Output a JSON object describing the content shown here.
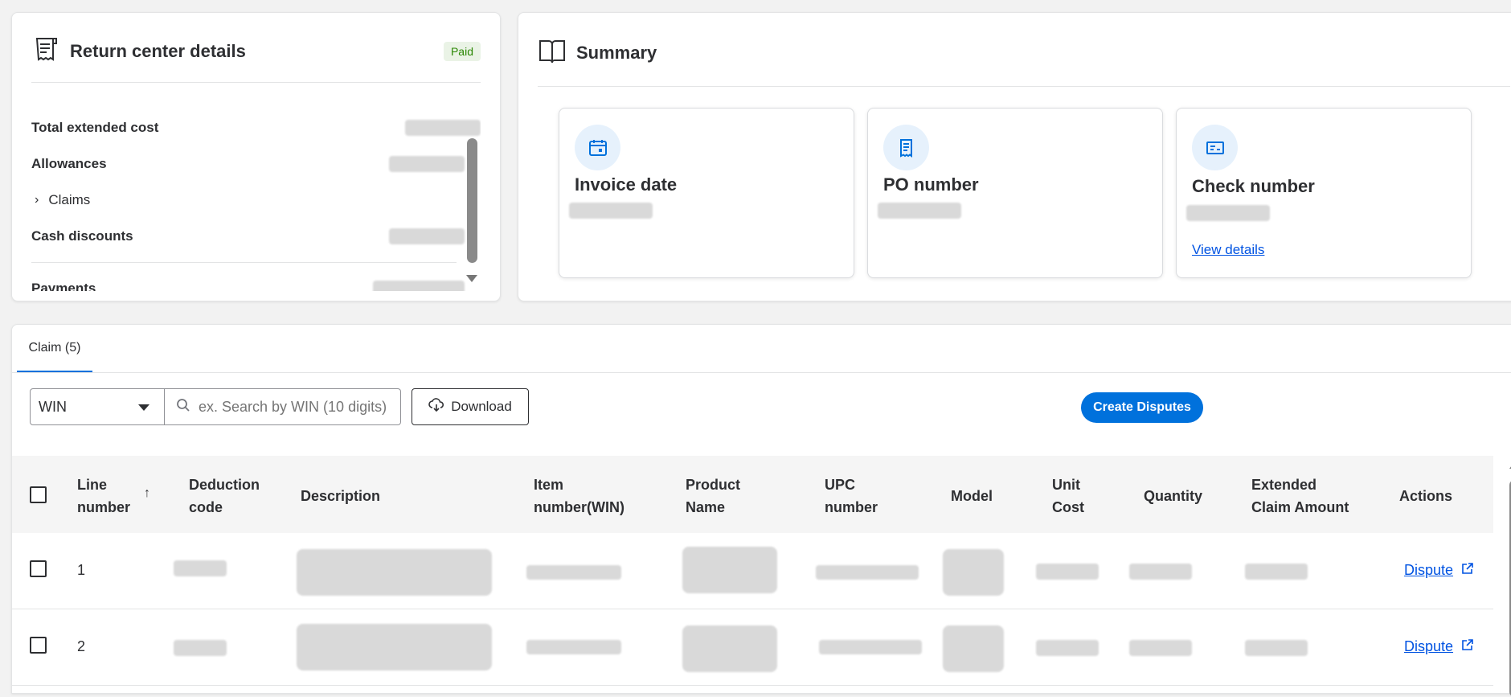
{
  "return_center": {
    "title": "Return center details",
    "status_badge": "Paid",
    "rows": [
      {
        "label": "Total extended cost"
      },
      {
        "label": "Allowances"
      },
      {
        "label": "Claims"
      },
      {
        "label": "Cash discounts"
      },
      {
        "label": "Payments"
      }
    ]
  },
  "summary": {
    "title": "Summary",
    "cards": [
      {
        "title": "Invoice date",
        "icon": "calendar-icon"
      },
      {
        "title": "PO number",
        "icon": "receipt-icon"
      },
      {
        "title": "Check number",
        "icon": "check-icon",
        "link": "View details"
      }
    ]
  },
  "claims": {
    "tab_label": "Claim (5)",
    "filter_select": "WIN",
    "search_placeholder": "ex. Search by WIN (10 digits)",
    "download_label": "Download",
    "create_disputes_label": "Create Disputes",
    "columns": {
      "line_number": [
        "Line",
        "number"
      ],
      "deduction_code": [
        "Deduction",
        "code"
      ],
      "description": "Description",
      "item_number": [
        "Item",
        "number(WIN)"
      ],
      "product_name": [
        "Product",
        "Name"
      ],
      "upc_number": [
        "UPC",
        "number"
      ],
      "model": "Model",
      "unit_cost": [
        "Unit",
        "Cost"
      ],
      "quantity": "Quantity",
      "extended_claim_amount": [
        "Extended",
        "Claim Amount"
      ],
      "actions": "Actions"
    },
    "rows": [
      {
        "line": "1",
        "action": "Dispute"
      },
      {
        "line": "2",
        "action": "Dispute"
      }
    ]
  },
  "colors": {
    "primary": "#0071dc",
    "link": "#0053e2",
    "paid_badge_bg": "#eaf3e6",
    "paid_badge_text": "#2a8703"
  }
}
